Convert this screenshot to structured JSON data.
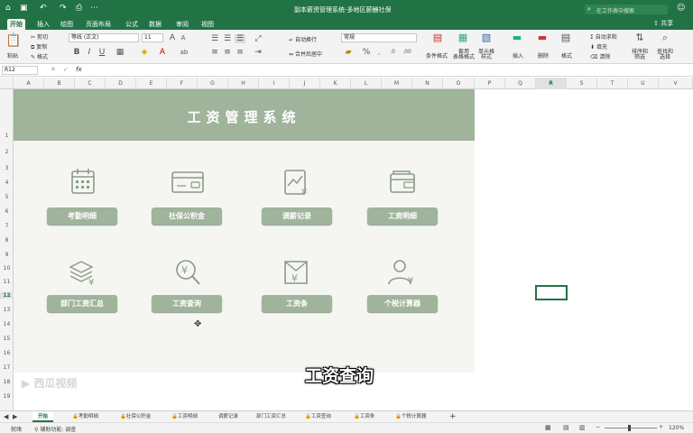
{
  "titlebar": {
    "doc_title": "副本薪资管理系统-多地区薪酬社保",
    "search_placeholder": "在工作表中搜索",
    "share_label": "共享"
  },
  "tabs": [
    "开始",
    "插入",
    "绘图",
    "页面布局",
    "公式",
    "数据",
    "审阅",
    "视图"
  ],
  "ribbon": {
    "paste": "粘贴",
    "cut": "剪切",
    "copy": "复制",
    "format_painter": "格式",
    "font_name": "等线 (正文)",
    "font_size": "11",
    "bold": "B",
    "italic": "I",
    "underline": "U",
    "wrap_text": "自动换行",
    "merge_center": "合并后居中",
    "number_format": "常规",
    "conditional_format": "条件格式",
    "format_as_table": "套用\n表格格式",
    "cell_styles": "单元格\n样式",
    "insert": "插入",
    "delete": "删除",
    "format": "格式",
    "autosum": "自动求和",
    "fill": "填充",
    "clear": "清除",
    "sort_filter": "排序和\n筛选",
    "find_select": "查找和\n选择"
  },
  "formula_bar": {
    "name_box": "R12",
    "fx": "fx",
    "value": ""
  },
  "columns": [
    "A",
    "B",
    "C",
    "D",
    "E",
    "F",
    "G",
    "H",
    "I",
    "J",
    "K",
    "L",
    "M",
    "N",
    "O",
    "P",
    "Q",
    "R",
    "S",
    "T",
    "U",
    "V"
  ],
  "rows": [
    "1",
    "2",
    "3",
    "4",
    "5",
    "6",
    "7",
    "8",
    "9",
    "10",
    "11",
    "12",
    "13",
    "14",
    "15",
    "16",
    "17",
    "18",
    "19"
  ],
  "dashboard": {
    "title": "工资管理系统",
    "buttons": [
      "考勤明细",
      "社保公积金",
      "调薪记录",
      "工资明细",
      "部门工资汇总",
      "工资查询",
      "工资条",
      "个税计算器"
    ],
    "icons": [
      "calendar-icon",
      "card-icon",
      "salary-chart-icon",
      "wallet-icon",
      "money-stack-icon",
      "search-yen-icon",
      "pay-slip-icon",
      "person-yen-icon"
    ],
    "banner_color": "#9fb49b",
    "panel_color": "#f5f6f1"
  },
  "subtitle": "工资查询",
  "watermark": "西瓜视频",
  "sheet_tabs": [
    "开始",
    "考勤明细",
    "社保公积金",
    "工资明细",
    "调薪记录",
    "部门工资汇总",
    "工资查询",
    "工资条",
    "个税计算器"
  ],
  "status": {
    "ready": "就绪",
    "accessibility": "辅助功能: 调查",
    "zoom": "120%"
  },
  "colors": {
    "excel_green": "#217346"
  }
}
